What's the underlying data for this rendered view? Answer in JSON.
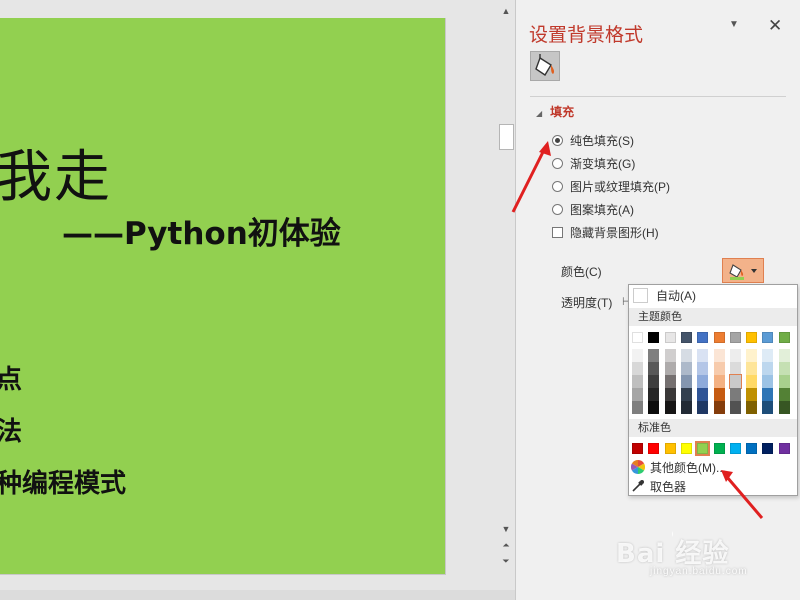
{
  "slide": {
    "background_color": "#92d050",
    "title_fragment": "我走",
    "subtitle": "——Python初体验",
    "bullets": [
      "点",
      "法",
      "种编程模式"
    ]
  },
  "pane": {
    "title": "设置背景格式",
    "title_color": "#c0392b",
    "category_icon": "paint-bucket-icon",
    "fill_section": "填充",
    "fill_options": [
      {
        "label": "纯色填充(S)",
        "checked": true
      },
      {
        "label": "渐变填充(G)",
        "checked": false
      },
      {
        "label": "图片或纹理填充(P)",
        "checked": false
      },
      {
        "label": "图案填充(A)",
        "checked": false
      }
    ],
    "hide_background_label": "隐藏背景图形(H)",
    "color_label": "颜色(C)",
    "transparency_label": "透明度(T)"
  },
  "color_menu": {
    "auto_label": "自动(A)",
    "theme_colors_label": "主题颜色",
    "theme_colors": [
      "#ffffff",
      "#000000",
      "#e7e6e6",
      "#44546a",
      "#4472c4",
      "#ed7d31",
      "#a5a5a5",
      "#ffc000",
      "#5b9bd5",
      "#70ad47"
    ],
    "theme_shades": [
      [
        "#f2f2f2",
        "#7f7f7f",
        "#d0cece",
        "#d6dce4",
        "#d9e2f3",
        "#fbe5d5",
        "#ededed",
        "#fff2cc",
        "#deebf6",
        "#e2efd9"
      ],
      [
        "#d8d8d8",
        "#595959",
        "#aeabab",
        "#adb9ca",
        "#b4c6e7",
        "#f7cbac",
        "#dbdbdb",
        "#fee599",
        "#bdd7ee",
        "#c5e0b3"
      ],
      [
        "#bfbfbf",
        "#3f3f3f",
        "#757070",
        "#8496b0",
        "#8eaadb",
        "#f4b183",
        "#c9c9c9",
        "#ffd965",
        "#9cc3e5",
        "#a8d08d"
      ],
      [
        "#a5a5a5",
        "#262626",
        "#3a3838",
        "#323f4f",
        "#2f5496",
        "#c55a11",
        "#7b7b7b",
        "#bf9000",
        "#2e75b5",
        "#538135"
      ],
      [
        "#7f7f7f",
        "#0c0c0c",
        "#171616",
        "#222a35",
        "#1f3864",
        "#843c0b",
        "#525252",
        "#7f6000",
        "#1e4e79",
        "#375623"
      ]
    ],
    "standard_colors_label": "标准色",
    "standard_colors": [
      "#c00000",
      "#ff0000",
      "#ffc000",
      "#ffff00",
      "#92d050",
      "#00b050",
      "#00b0f0",
      "#0070c0",
      "#002060",
      "#7030a0"
    ],
    "selected_standard_color": "#92d050",
    "more_colors_label": "其他颜色(M)...",
    "eyedropper_label": "取色器"
  },
  "watermark": {
    "text": "Bai  经验",
    "url": "jingyan.baidu.com"
  }
}
